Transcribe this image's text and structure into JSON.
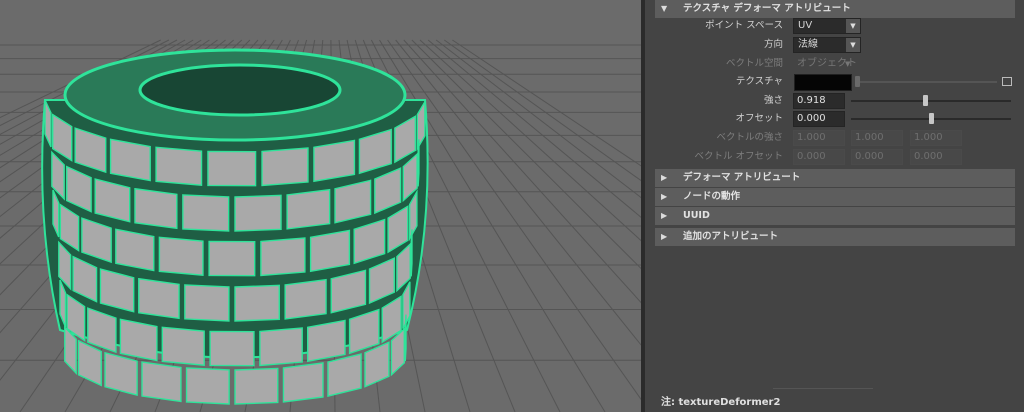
{
  "attribute_editor": {
    "sections": [
      {
        "label": "テクスチャ デフォーマ アトリビュート",
        "expanded": true
      },
      {
        "label": "デフォーマ アトリビュート",
        "expanded": false
      },
      {
        "label": "ノードの動作",
        "expanded": false
      },
      {
        "label": "UUID",
        "expanded": false
      },
      {
        "label": "追加のアトリビュート",
        "expanded": false
      }
    ],
    "fields": {
      "point_space": {
        "label": "ポイント スペース",
        "value": "UV"
      },
      "direction": {
        "label": "方向",
        "value": "法線"
      },
      "vector_space": {
        "label": "ベクトル空間",
        "value": "オブジェクト"
      },
      "texture": {
        "label": "テクスチャ",
        "color": "#000000"
      },
      "strength": {
        "label": "強さ",
        "value": "0.918",
        "slider": 0.46
      },
      "offset": {
        "label": "オフセット",
        "value": "0.000",
        "slider": 0.5
      },
      "vector_strength": {
        "label": "ベクトルの強さ",
        "values": [
          "1.000",
          "1.000",
          "1.000"
        ]
      },
      "vector_offset": {
        "label": "ベクトル オフセット",
        "values": [
          "0.000",
          "0.000",
          "0.000"
        ]
      }
    },
    "note": "注:  textureDeformer2"
  },
  "colors": {
    "wireframe": "#2fe39a",
    "viewport_bg": "#6b6b6b",
    "panel_bg": "#444444"
  }
}
